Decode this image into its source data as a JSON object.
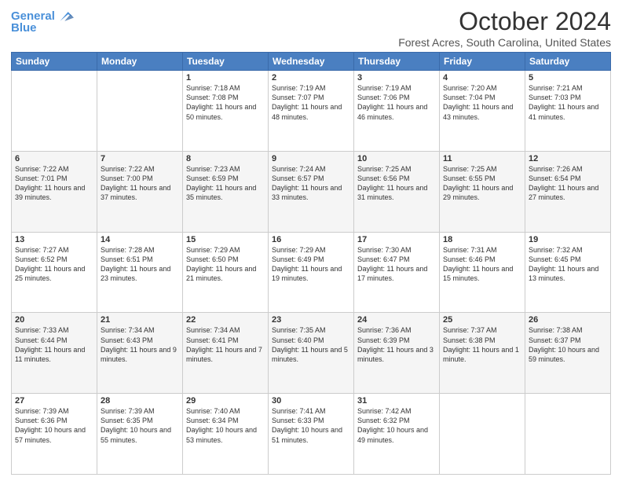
{
  "header": {
    "logo_line1": "General",
    "logo_line2": "Blue",
    "title": "October 2024",
    "subtitle": "Forest Acres, South Carolina, United States"
  },
  "days_of_week": [
    "Sunday",
    "Monday",
    "Tuesday",
    "Wednesday",
    "Thursday",
    "Friday",
    "Saturday"
  ],
  "weeks": [
    [
      {
        "day": "",
        "info": ""
      },
      {
        "day": "",
        "info": ""
      },
      {
        "day": "1",
        "info": "Sunrise: 7:18 AM\nSunset: 7:08 PM\nDaylight: 11 hours and 50 minutes."
      },
      {
        "day": "2",
        "info": "Sunrise: 7:19 AM\nSunset: 7:07 PM\nDaylight: 11 hours and 48 minutes."
      },
      {
        "day": "3",
        "info": "Sunrise: 7:19 AM\nSunset: 7:06 PM\nDaylight: 11 hours and 46 minutes."
      },
      {
        "day": "4",
        "info": "Sunrise: 7:20 AM\nSunset: 7:04 PM\nDaylight: 11 hours and 43 minutes."
      },
      {
        "day": "5",
        "info": "Sunrise: 7:21 AM\nSunset: 7:03 PM\nDaylight: 11 hours and 41 minutes."
      }
    ],
    [
      {
        "day": "6",
        "info": "Sunrise: 7:22 AM\nSunset: 7:01 PM\nDaylight: 11 hours and 39 minutes."
      },
      {
        "day": "7",
        "info": "Sunrise: 7:22 AM\nSunset: 7:00 PM\nDaylight: 11 hours and 37 minutes."
      },
      {
        "day": "8",
        "info": "Sunrise: 7:23 AM\nSunset: 6:59 PM\nDaylight: 11 hours and 35 minutes."
      },
      {
        "day": "9",
        "info": "Sunrise: 7:24 AM\nSunset: 6:57 PM\nDaylight: 11 hours and 33 minutes."
      },
      {
        "day": "10",
        "info": "Sunrise: 7:25 AM\nSunset: 6:56 PM\nDaylight: 11 hours and 31 minutes."
      },
      {
        "day": "11",
        "info": "Sunrise: 7:25 AM\nSunset: 6:55 PM\nDaylight: 11 hours and 29 minutes."
      },
      {
        "day": "12",
        "info": "Sunrise: 7:26 AM\nSunset: 6:54 PM\nDaylight: 11 hours and 27 minutes."
      }
    ],
    [
      {
        "day": "13",
        "info": "Sunrise: 7:27 AM\nSunset: 6:52 PM\nDaylight: 11 hours and 25 minutes."
      },
      {
        "day": "14",
        "info": "Sunrise: 7:28 AM\nSunset: 6:51 PM\nDaylight: 11 hours and 23 minutes."
      },
      {
        "day": "15",
        "info": "Sunrise: 7:29 AM\nSunset: 6:50 PM\nDaylight: 11 hours and 21 minutes."
      },
      {
        "day": "16",
        "info": "Sunrise: 7:29 AM\nSunset: 6:49 PM\nDaylight: 11 hours and 19 minutes."
      },
      {
        "day": "17",
        "info": "Sunrise: 7:30 AM\nSunset: 6:47 PM\nDaylight: 11 hours and 17 minutes."
      },
      {
        "day": "18",
        "info": "Sunrise: 7:31 AM\nSunset: 6:46 PM\nDaylight: 11 hours and 15 minutes."
      },
      {
        "day": "19",
        "info": "Sunrise: 7:32 AM\nSunset: 6:45 PM\nDaylight: 11 hours and 13 minutes."
      }
    ],
    [
      {
        "day": "20",
        "info": "Sunrise: 7:33 AM\nSunset: 6:44 PM\nDaylight: 11 hours and 11 minutes."
      },
      {
        "day": "21",
        "info": "Sunrise: 7:34 AM\nSunset: 6:43 PM\nDaylight: 11 hours and 9 minutes."
      },
      {
        "day": "22",
        "info": "Sunrise: 7:34 AM\nSunset: 6:41 PM\nDaylight: 11 hours and 7 minutes."
      },
      {
        "day": "23",
        "info": "Sunrise: 7:35 AM\nSunset: 6:40 PM\nDaylight: 11 hours and 5 minutes."
      },
      {
        "day": "24",
        "info": "Sunrise: 7:36 AM\nSunset: 6:39 PM\nDaylight: 11 hours and 3 minutes."
      },
      {
        "day": "25",
        "info": "Sunrise: 7:37 AM\nSunset: 6:38 PM\nDaylight: 11 hours and 1 minute."
      },
      {
        "day": "26",
        "info": "Sunrise: 7:38 AM\nSunset: 6:37 PM\nDaylight: 10 hours and 59 minutes."
      }
    ],
    [
      {
        "day": "27",
        "info": "Sunrise: 7:39 AM\nSunset: 6:36 PM\nDaylight: 10 hours and 57 minutes."
      },
      {
        "day": "28",
        "info": "Sunrise: 7:39 AM\nSunset: 6:35 PM\nDaylight: 10 hours and 55 minutes."
      },
      {
        "day": "29",
        "info": "Sunrise: 7:40 AM\nSunset: 6:34 PM\nDaylight: 10 hours and 53 minutes."
      },
      {
        "day": "30",
        "info": "Sunrise: 7:41 AM\nSunset: 6:33 PM\nDaylight: 10 hours and 51 minutes."
      },
      {
        "day": "31",
        "info": "Sunrise: 7:42 AM\nSunset: 6:32 PM\nDaylight: 10 hours and 49 minutes."
      },
      {
        "day": "",
        "info": ""
      },
      {
        "day": "",
        "info": ""
      }
    ]
  ]
}
